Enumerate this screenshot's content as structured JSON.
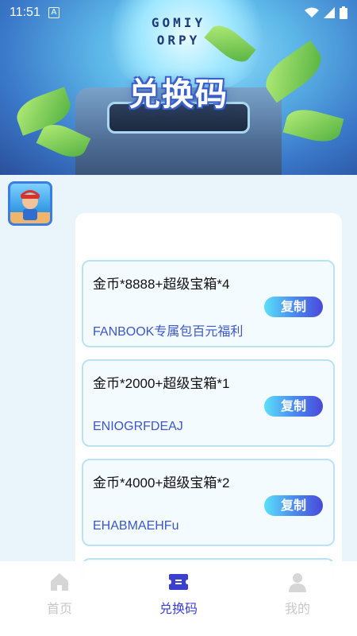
{
  "status_bar": {
    "time": "11:51",
    "keyboard_indicator": "A"
  },
  "hero": {
    "logo_text_line1": "GOMIY",
    "logo_text_line2": "ORPY",
    "title": "兑换码"
  },
  "codes": [
    {
      "reward": "金币*8888+超级宝箱*4",
      "code": "FANBOOK专属包百元福利",
      "copy_label": "复制"
    },
    {
      "reward": "金币*2000+超级宝箱*1",
      "code": "ENIOGRFDEAJ",
      "copy_label": "复制"
    },
    {
      "reward": "金币*4000+超级宝箱*2",
      "code": "EHABMAEHFu",
      "copy_label": "复制"
    }
  ],
  "bottom_nav": {
    "items": [
      {
        "label": "首页",
        "icon": "home-icon",
        "active": false
      },
      {
        "label": "兑换码",
        "icon": "ticket-icon",
        "active": true
      },
      {
        "label": "我的",
        "icon": "user-icon",
        "active": false
      }
    ]
  },
  "colors": {
    "accent": "#3b3fcf",
    "code_text": "#3a57c9",
    "card_border": "#b9e2f5"
  }
}
